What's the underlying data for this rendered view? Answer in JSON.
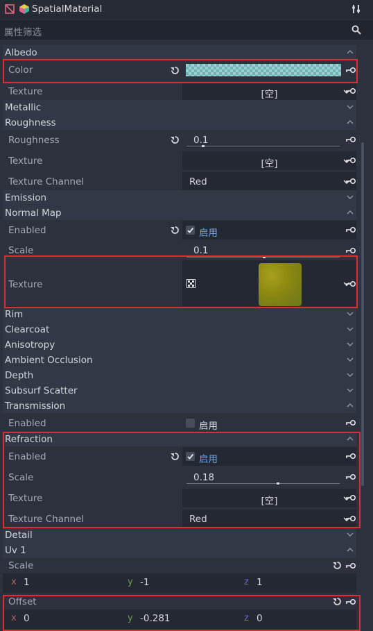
{
  "header": {
    "title": "SpatialMaterial"
  },
  "filter": {
    "placeholder": "属性筛选"
  },
  "sections": {
    "albedo": "Albedo",
    "metallic": "Metallic",
    "roughness": "Roughness",
    "emission": "Emission",
    "normal_map": "Normal Map",
    "rim": "Rim",
    "clearcoat": "Clearcoat",
    "anisotropy": "Anisotropy",
    "ambient_occlusion": "Ambient Occlusion",
    "depth": "Depth",
    "subsurf_scatter": "Subsurf Scatter",
    "transmission": "Transmission",
    "refraction": "Refraction",
    "detail": "Detail",
    "uv1": "Uv 1"
  },
  "albedo": {
    "color_label": "Color",
    "color_value": "#7fb5b8",
    "texture_label": "Texture",
    "texture_value": "[空]"
  },
  "roughness": {
    "label": "Roughness",
    "value": "0.1",
    "texture_label": "Texture",
    "texture_value": "[空]",
    "channel_label": "Texture Channel",
    "channel_value": "Red"
  },
  "normal_map": {
    "enabled_label": "Enabled",
    "enabled_text": "启用",
    "enabled": true,
    "scale_label": "Scale",
    "scale_value": "0.1",
    "texture_label": "Texture"
  },
  "transmission": {
    "enabled_label": "Enabled",
    "enabled_text": "启用",
    "enabled": false
  },
  "refraction": {
    "enabled_label": "Enabled",
    "enabled_text": "启用",
    "enabled": true,
    "scale_label": "Scale",
    "scale_value": "0.18",
    "texture_label": "Texture",
    "texture_value": "[空]",
    "channel_label": "Texture Channel",
    "channel_value": "Red"
  },
  "uv1": {
    "scale_label": "Scale",
    "scale": {
      "x_label": "x",
      "x": "1",
      "y_label": "y",
      "y": "-1",
      "z_label": "z",
      "z": "1"
    },
    "offset_label": "Offset",
    "offset": {
      "x_label": "x",
      "x": "0",
      "y_label": "y",
      "y": "-0.281",
      "z_label": "z",
      "z": "0"
    }
  },
  "colors": {
    "accent": "#6ea6e8",
    "highlight_box": "#e02d2d",
    "axis_x": "#b36060",
    "axis_y": "#6c9e4a",
    "axis_z": "#6a6ad0"
  },
  "icons": [
    "material-icon",
    "sphere-icon",
    "tools-icon",
    "search-icon",
    "revert-icon",
    "key-icon",
    "chevron-down-icon",
    "chevron-up-icon",
    "texture-preview-icon",
    "checkbox-icon"
  ]
}
